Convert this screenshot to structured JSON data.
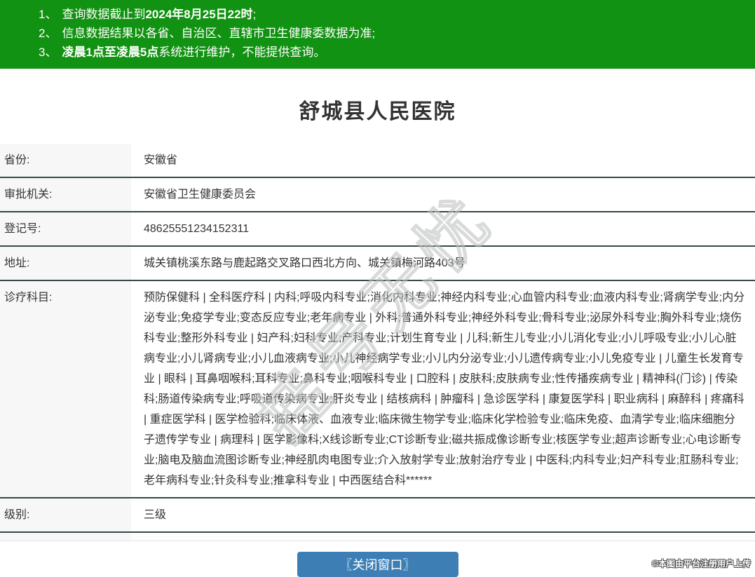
{
  "banner": {
    "bg_color": "#129212",
    "notices": [
      {
        "num": "1、",
        "prefix": "查询数据截止到",
        "bold": "2024年8月25日22时",
        "suffix": ";"
      },
      {
        "num": "2、",
        "prefix": "信息数据结果以各省、自治区、直辖市卫生健康委数据为准;",
        "bold": "",
        "suffix": ""
      },
      {
        "num": "3、",
        "prefix": "",
        "bold": "凌晨1点至凌晨5点",
        "suffix": "系统进行维护，不能提供查询。"
      }
    ]
  },
  "title": "舒城县人民医院",
  "table": {
    "rows": [
      {
        "label": "省份:",
        "value": "安徽省"
      },
      {
        "label": "审批机关:",
        "value": "安徽省卫生健康委员会"
      },
      {
        "label": "登记号:",
        "value": "48625551234152311"
      },
      {
        "label": "地址:",
        "value": "城关镇桃溪东路与鹿起路交叉路口西北方向、城关镇梅河路403号"
      },
      {
        "label": "诊疗科目:",
        "value": "预防保健科 | 全科医疗科 | 内科;呼吸内科专业;消化内科专业;神经内科专业;心血管内科专业;血液内科专业;肾病学专业;内分泌专业;免疫学专业;变态反应专业;老年病专业 | 外科;普通外科专业;神经外科专业;骨科专业;泌尿外科专业;胸外科专业;烧伤科专业;整形外科专业 | 妇产科;妇科专业;产科专业;计划生育专业 | 儿科;新生儿专业;小儿消化专业;小儿呼吸专业;小儿心脏病专业;小儿肾病专业;小儿血液病专业;小儿神经病学专业;小儿内分泌专业;小儿遗传病专业;小儿免疫专业 | 儿童生长发育专业 | 眼科 | 耳鼻咽喉科;耳科专业;鼻科专业;咽喉科专业 | 口腔科 | 皮肤科;皮肤病专业;性传播疾病专业 | 精神科(门诊) | 传染科;肠道传染病专业;呼吸道传染病专业;肝炎专业 | 结核病科 | 肿瘤科 | 急诊医学科 | 康复医学科 | 职业病科 | 麻醉科 | 疼痛科 | 重症医学科 | 医学检验科;临床体液、血液专业;临床微生物学专业;临床化学检验专业;临床免疫、血清学专业;临床细胞分子遗传学专业 | 病理科 | 医学影像科;X线诊断专业;CT诊断专业;磁共振成像诊断专业;核医学专业;超声诊断专业;心电诊断专业;脑电及脑血流图诊断专业;神经肌肉电图专业;介入放射学专业;放射治疗专业 | 中医科;内科专业;妇产科专业;肛肠科专业;老年病科专业;针灸科专业;推拿科专业 | 中西医结合科******"
      },
      {
        "label": "级别:",
        "value": "三级"
      }
    ]
  },
  "close_button": {
    "label": "〖关闭窗口〗",
    "bg_color": "#3d7fb4"
  },
  "watermark": {
    "diagonal_text": "挂号无忧",
    "credit_text": "©本图由平台注册用户上传"
  }
}
